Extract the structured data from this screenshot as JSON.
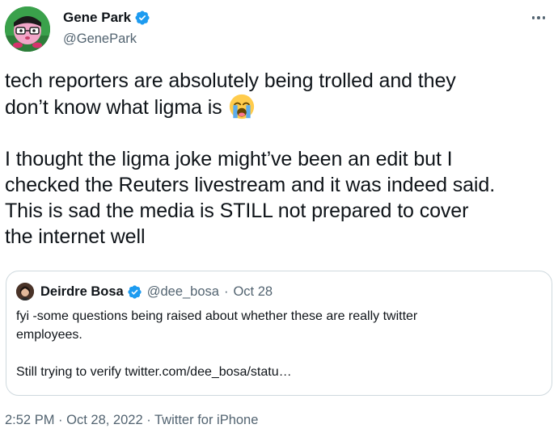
{
  "author": {
    "display_name": "Gene Park",
    "handle": "@GenePark",
    "avatar_icon": "pixel-character-avatar-icon",
    "verified_icon": "verified-badge-icon",
    "verified_color": "#1d9bf0"
  },
  "more_icon": "more-options-icon",
  "tweet": {
    "lines": [
      "tech reporters are absolutely being trolled and they",
      "don’t know what ligma is",
      "I thought the ligma joke might’ve been an edit but I",
      "checked the Reuters livestream and it was indeed said.",
      "This is sad the media is STILL not prepared to cover",
      "the internet well"
    ],
    "emoji_icon": "loudly-crying-face-emoji-icon"
  },
  "quote": {
    "display_name": "Deirdre Bosa",
    "handle": "@dee_bosa",
    "separator": "·",
    "date": "Oct 28",
    "lines": [
      "fyi -some questions being raised about whether these are really twitter",
      "employees.",
      "Still trying to verify twitter.com/dee_bosa/statu…"
    ],
    "avatar_icon": "photo-avatar-icon",
    "verified_icon": "verified-badge-icon"
  },
  "meta": {
    "time": "2:52 PM",
    "separator": "·",
    "date": "Oct 28, 2022",
    "source": "Twitter for iPhone"
  }
}
